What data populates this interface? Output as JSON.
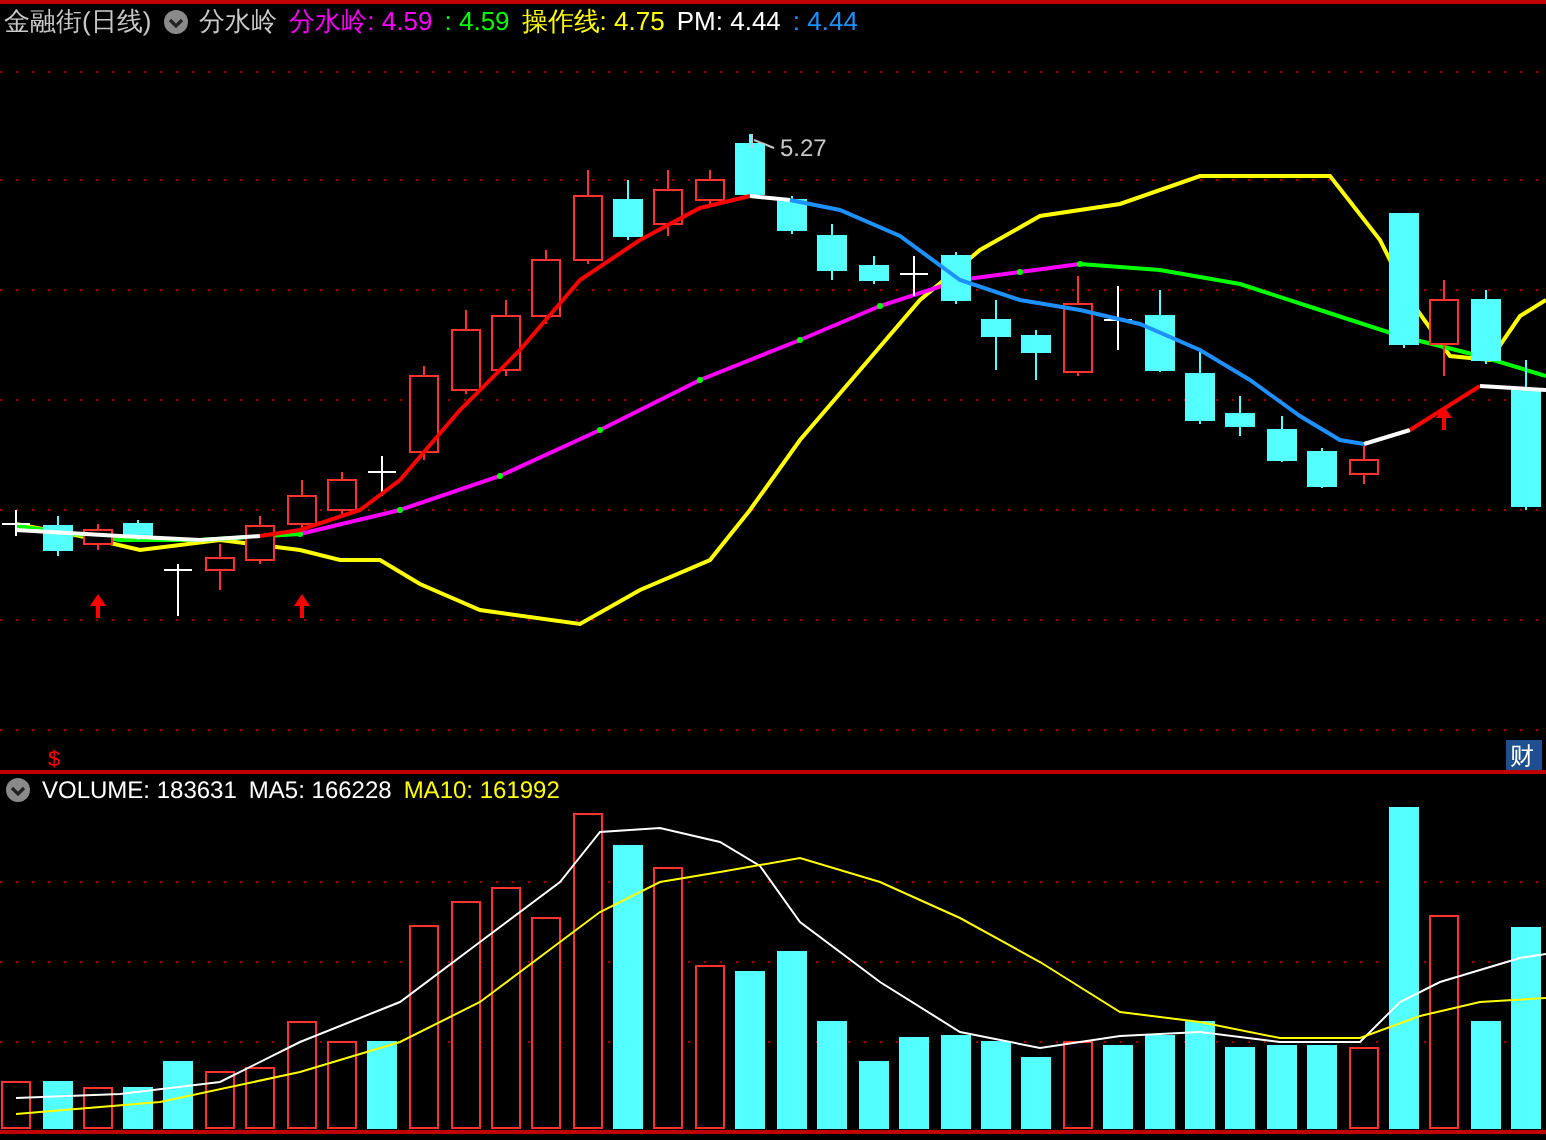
{
  "main_legend": {
    "title": "金融街(日线)",
    "indicator": "分水岭",
    "items": [
      {
        "label": "分水岭:",
        "value": "4.59",
        "color": "#ff00ff"
      },
      {
        "label": ":",
        "value": "4.59",
        "color": "#00ff00"
      },
      {
        "label": "操作线:",
        "value": "4.75",
        "color": "#ffff00"
      },
      {
        "label": "PM:",
        "value": "4.44",
        "color": "#ffffff"
      },
      {
        "label": ":",
        "value": "4.44",
        "color": "#1e90ff"
      }
    ]
  },
  "main_chart": {
    "high_label": "5.27",
    "signal_mark": "$",
    "finance_badge": "财"
  },
  "volume_legend": {
    "items": [
      {
        "label": "VOLUME:",
        "value": "183631",
        "color": "#ffffff"
      },
      {
        "label": "MA5:",
        "value": "166228",
        "color": "#ffffff"
      },
      {
        "label": "MA10:",
        "value": "161992",
        "color": "#ffff00"
      }
    ]
  }
}
